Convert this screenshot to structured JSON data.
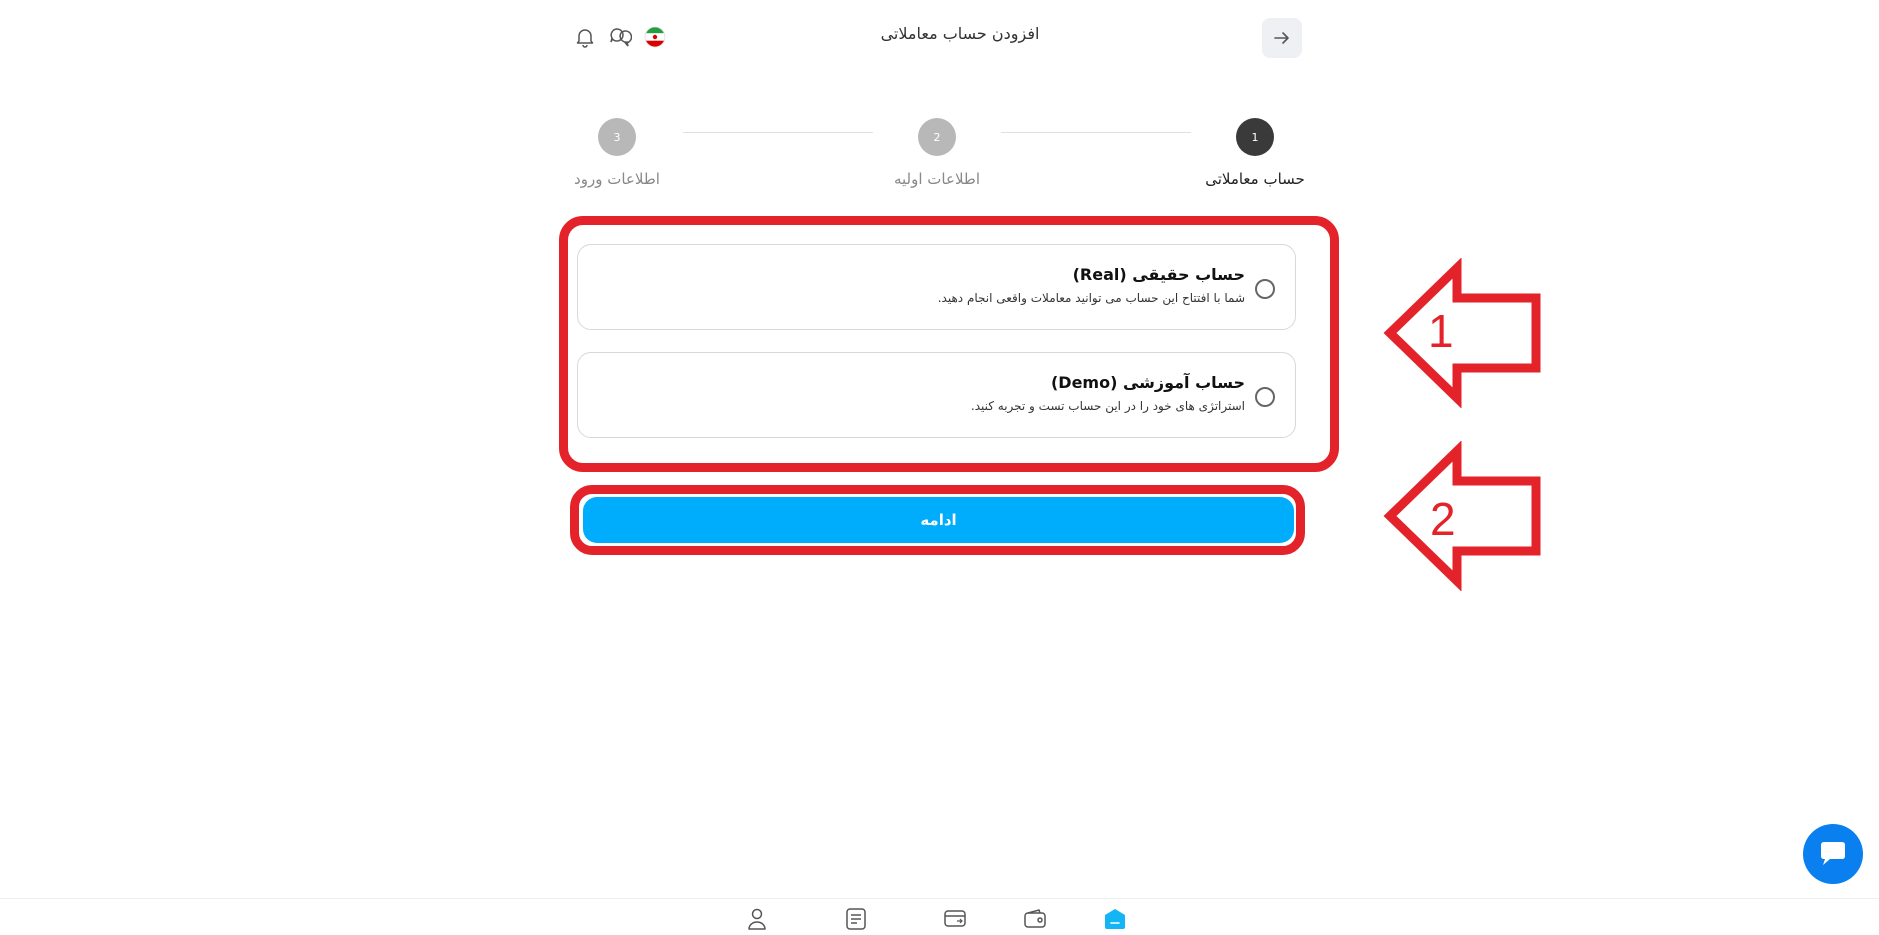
{
  "header": {
    "title": "افزودن حساب معاملاتی",
    "back_icon": "arrow-right-icon"
  },
  "stepper": {
    "steps": [
      {
        "number": "1",
        "label": "حساب معاملاتی",
        "state": "active",
        "color": "#3a3a3a"
      },
      {
        "number": "2",
        "label": "اطلاعات اولیه",
        "state": "pending",
        "color": "#b8b8b8"
      },
      {
        "number": "3",
        "label": "اطلاعات ورود",
        "state": "pending",
        "color": "#b8b8b8"
      }
    ]
  },
  "options": [
    {
      "title": "حساب حقیقی (Real)",
      "description": "شما با افتتاح این حساب می توانید معاملات واقعی انجام دهید.",
      "selected": false
    },
    {
      "title": "حساب آموزشی (Demo)",
      "description": "استراتژی های خود را در این حساب تست و تجربه کنید.",
      "selected": false
    }
  ],
  "continue_button": {
    "label": "ادامه"
  },
  "annotations": {
    "arrow_1": "1",
    "arrow_2": "2"
  },
  "colors": {
    "accent": "#00adfc",
    "annotation_red": "#e32229",
    "chat_fab": "#0a80f0",
    "active_nav": "#14b5f5"
  },
  "bottom_nav": [
    "profile-icon",
    "orders-icon",
    "card-exchange-icon",
    "wallet-icon",
    "home-icon"
  ]
}
